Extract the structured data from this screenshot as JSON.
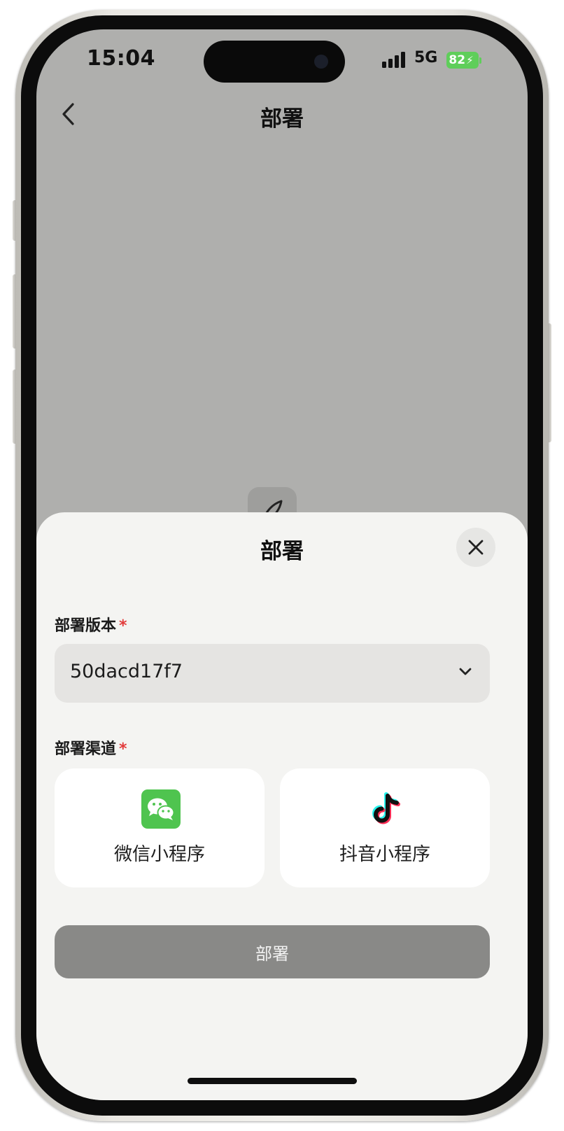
{
  "status_bar": {
    "time": "15:04",
    "network": "5G",
    "battery_level": "82",
    "battery_color": "#5fce5a"
  },
  "nav": {
    "title": "部署",
    "back_icon": "chevron-left-icon"
  },
  "sheet": {
    "title": "部署",
    "close_icon": "close-icon",
    "version_field": {
      "label": "部署版本",
      "required_mark": "*",
      "value": "50dacd17f7",
      "icon": "chevron-down-icon"
    },
    "channel_field": {
      "label": "部署渠道",
      "required_mark": "*",
      "options": [
        {
          "label": "微信小程序",
          "icon": "wechat-icon",
          "color": "#4fc44f"
        },
        {
          "label": "抖音小程序",
          "icon": "douyin-icon",
          "color": "#111111"
        }
      ]
    },
    "deploy_button": {
      "label": "部署",
      "state": "disabled"
    }
  },
  "colors": {
    "required": "#e23b3b",
    "sheet_background": "#f4f4f2",
    "screen_dim": "#afafad"
  }
}
